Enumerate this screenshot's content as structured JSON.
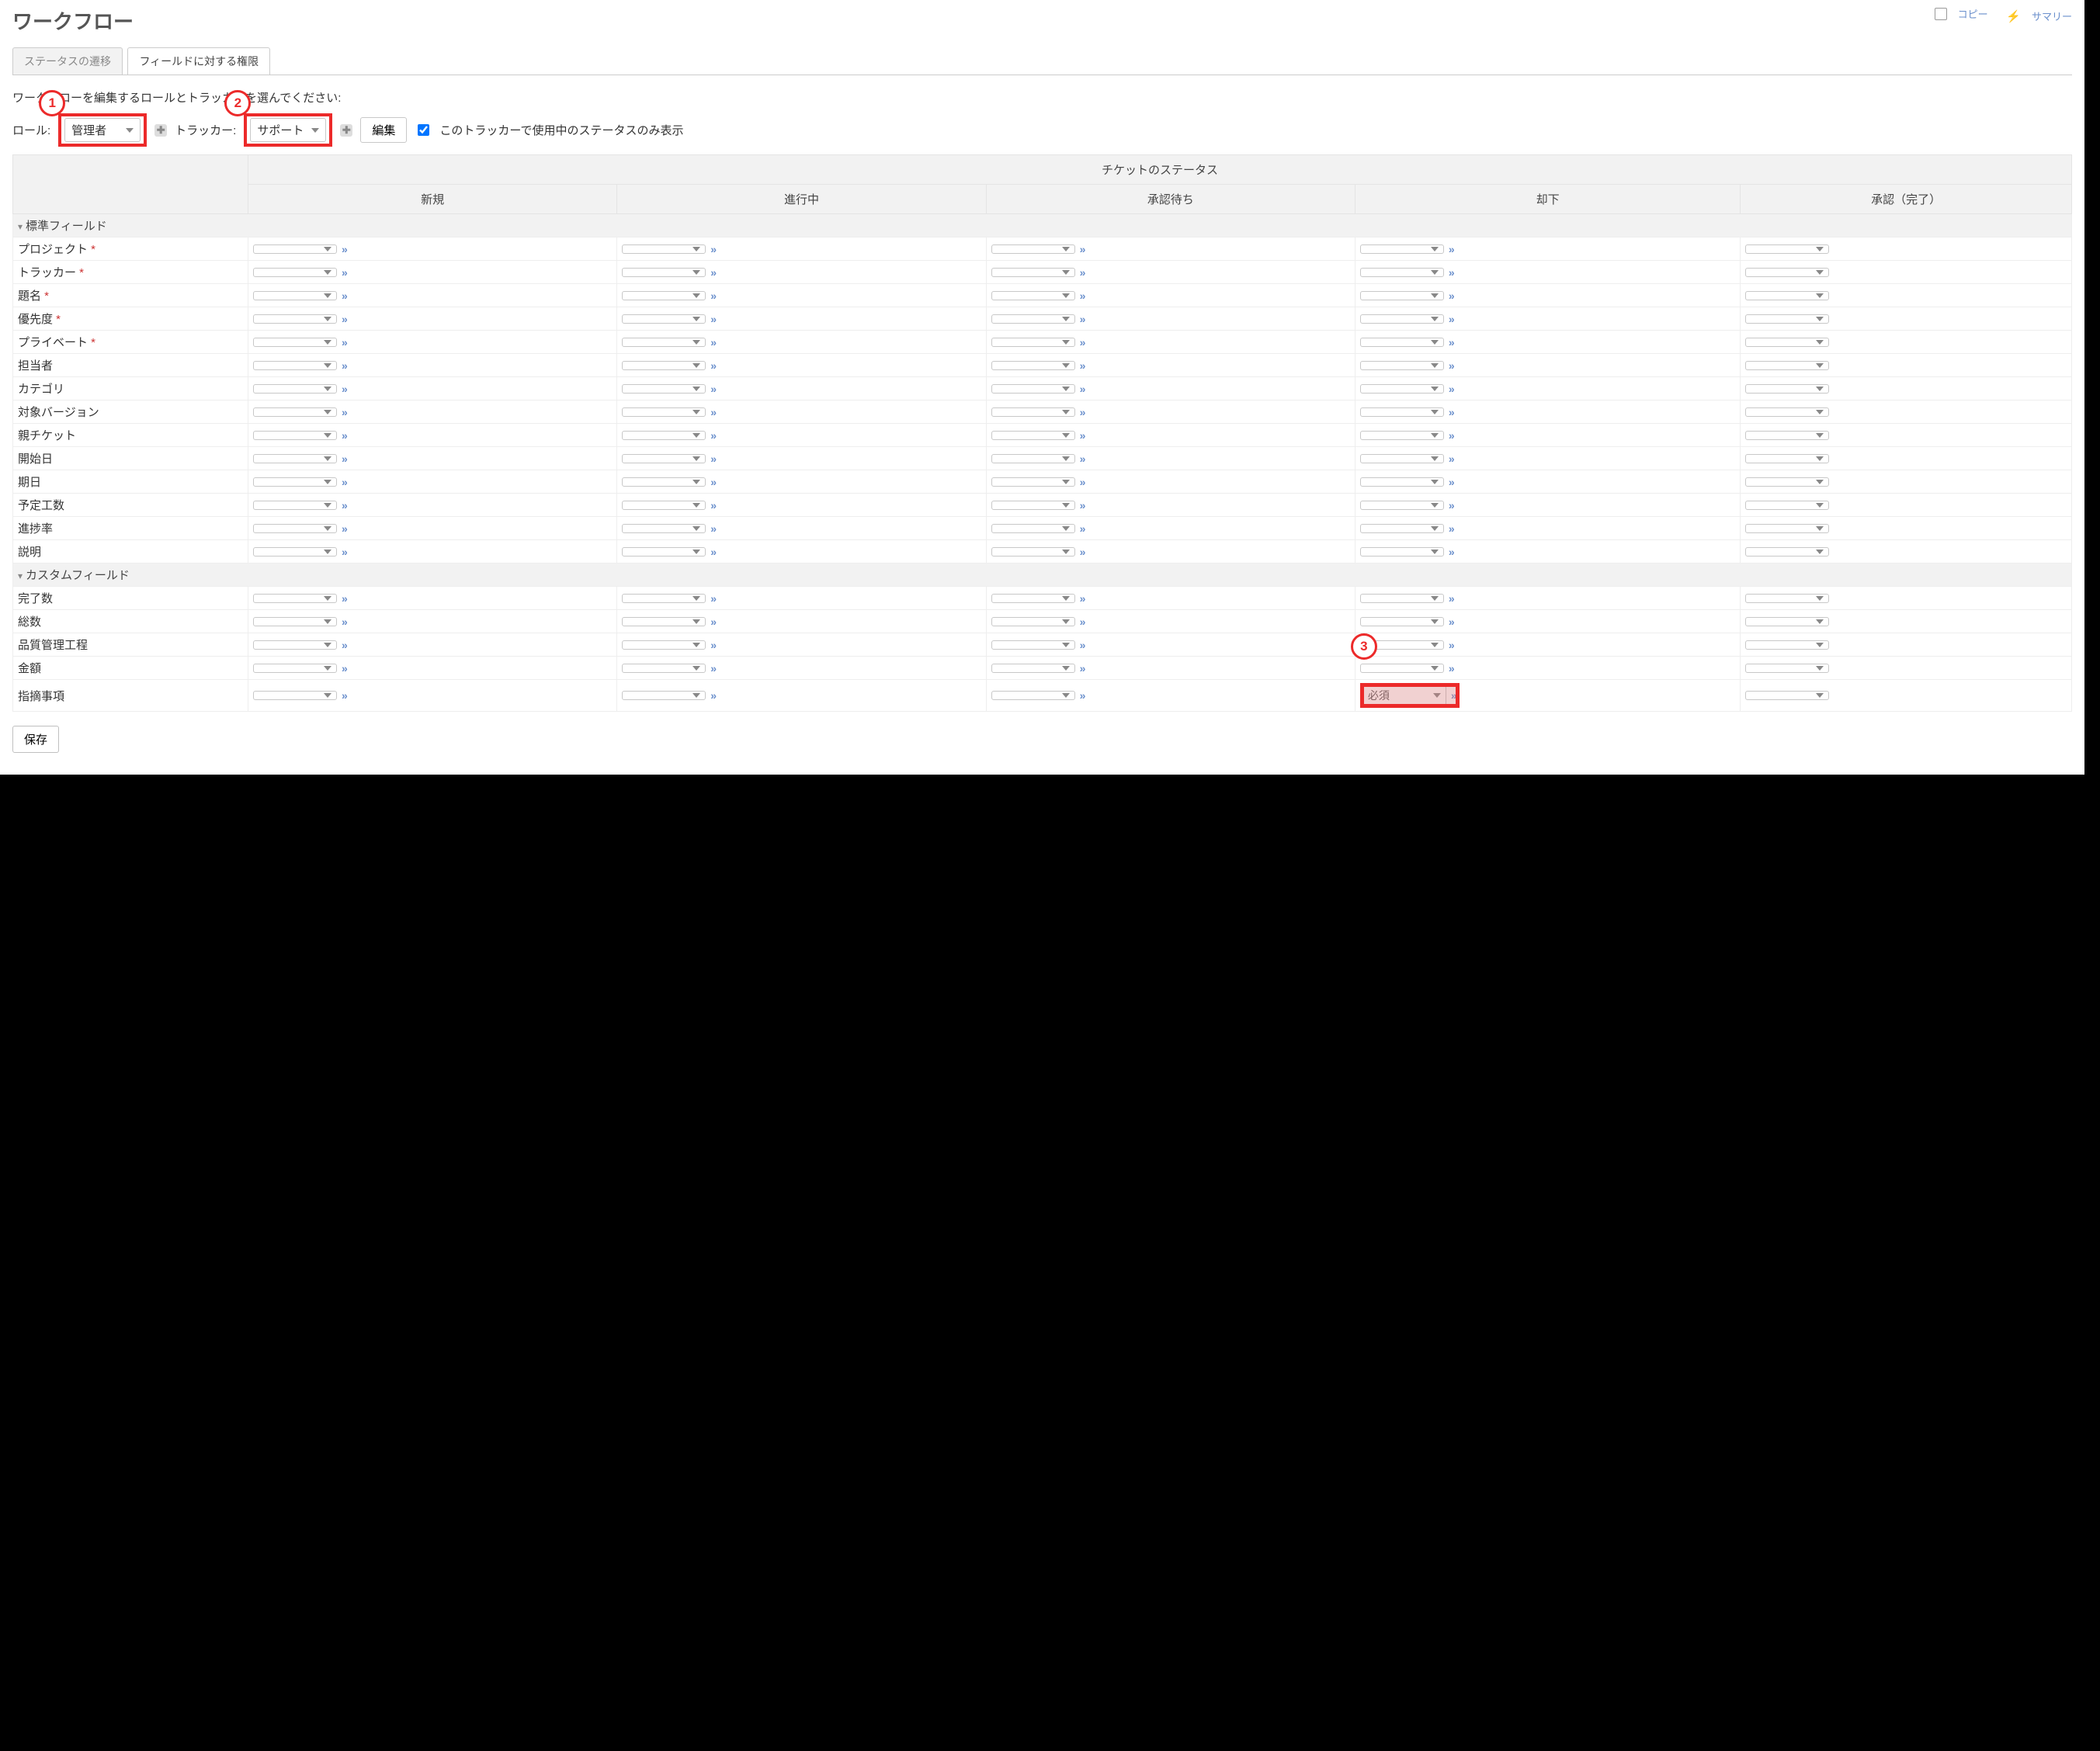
{
  "header": {
    "title": "ワークフロー",
    "copy": "コピー",
    "summary": "サマリー"
  },
  "tabs": {
    "transitions": "ステータスの遷移",
    "field_perm": "フィールドに対する権限"
  },
  "instruction": "ワークフローを編集するロールとトラッカーを選んでください:",
  "filters": {
    "role_label": "ロール:",
    "role_value": "管理者",
    "tracker_label": "トラッカー:",
    "tracker_value": "サポート",
    "edit": "編集",
    "checkbox_label": "このトラッカーで使用中のステータスのみ表示"
  },
  "markers": {
    "m1": "1",
    "m2": "2",
    "m3": "3"
  },
  "table": {
    "group_header": "チケットのステータス",
    "statuses": [
      "新規",
      "進行中",
      "承認待ち",
      "却下",
      "承認（完了）"
    ],
    "section_standard": "標準フィールド",
    "section_custom": "カスタムフィールド",
    "standard_fields": [
      {
        "label": "プロジェクト",
        "req": true
      },
      {
        "label": "トラッカー",
        "req": true
      },
      {
        "label": "題名",
        "req": true
      },
      {
        "label": "優先度",
        "req": true
      },
      {
        "label": "プライベート",
        "req": true
      },
      {
        "label": "担当者",
        "req": false
      },
      {
        "label": "カテゴリ",
        "req": false
      },
      {
        "label": "対象バージョン",
        "req": false
      },
      {
        "label": "親チケット",
        "req": false
      },
      {
        "label": "開始日",
        "req": false
      },
      {
        "label": "期日",
        "req": false
      },
      {
        "label": "予定工数",
        "req": false
      },
      {
        "label": "進捗率",
        "req": false
      },
      {
        "label": "説明",
        "req": false
      }
    ],
    "custom_fields": [
      {
        "label": "完了数"
      },
      {
        "label": "総数"
      },
      {
        "label": "品質管理工程"
      },
      {
        "label": "金額"
      },
      {
        "label": "指摘事項"
      }
    ],
    "required_value": "必須"
  },
  "save": "保存"
}
